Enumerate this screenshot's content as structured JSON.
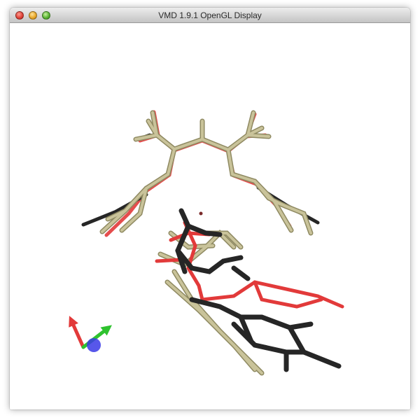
{
  "window": {
    "title": "VMD 1.9.1 OpenGL Display"
  },
  "scene": {
    "background": "#ffffff",
    "colors": {
      "tan": "#c9c39a",
      "tan_dark": "#8f8a62",
      "red": "#e23a3a",
      "black": "#262626",
      "axis_x": "#e23a3a",
      "axis_y": "#2ec22e",
      "axis_z": "#3a3ae6"
    }
  }
}
